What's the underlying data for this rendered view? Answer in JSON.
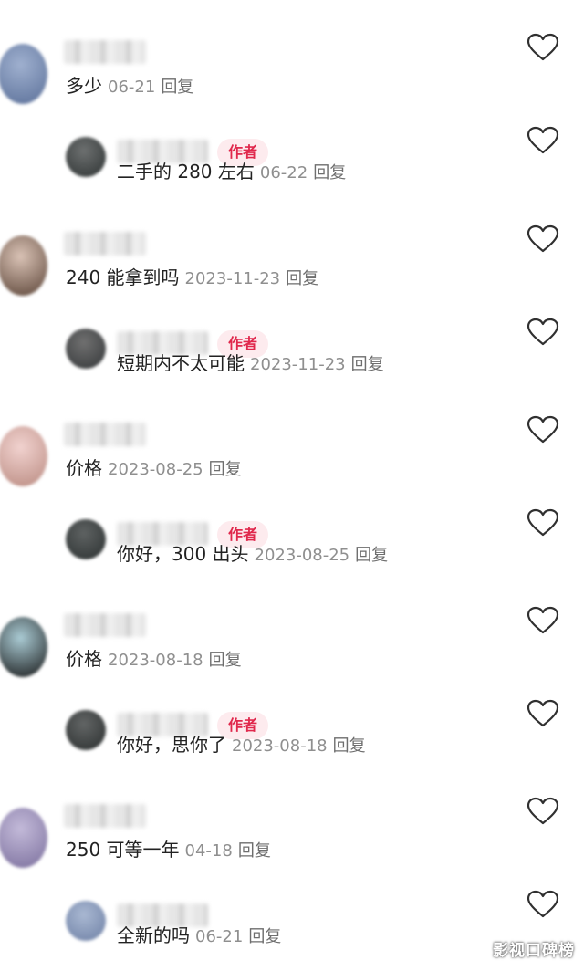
{
  "author_badge": "作者",
  "reply_label": "回复",
  "accent_color": "#e0284c",
  "watermark": "影视口碑榜",
  "comments": [
    {
      "type": "top",
      "text": "多少",
      "date": "06-21",
      "avatar_colors": [
        "#9fb0cf",
        "#5a6f98"
      ]
    },
    {
      "type": "reply",
      "text": "二手的 280 左右",
      "date": "06-22",
      "author": true,
      "avatar_colors": [
        "#6d7070",
        "#2d3232"
      ]
    },
    {
      "type": "top",
      "text": "240 能拿到吗",
      "date": "2023-11-23",
      "avatar_colors": [
        "#d9c2b5",
        "#5a4336"
      ]
    },
    {
      "type": "reply",
      "text": "短期内不太可能",
      "date": "2023-11-23",
      "author": true,
      "avatar_colors": [
        "#707070",
        "#333638"
      ]
    },
    {
      "type": "top",
      "text": "价格",
      "date": "2023-08-25",
      "avatar_colors": [
        "#f1d2cf",
        "#b98a80"
      ]
    },
    {
      "type": "reply",
      "text": "你好，300 出头",
      "date": "2023-08-25",
      "author": true,
      "avatar_colors": [
        "#5e6262",
        "#2b3030"
      ]
    },
    {
      "type": "top",
      "text": "价格",
      "date": "2023-08-18",
      "avatar_colors": [
        "#aacbd4",
        "#151515"
      ]
    },
    {
      "type": "reply",
      "text": "你好，思你了",
      "date": "2023-08-18",
      "author": true,
      "avatar_colors": [
        "#626565",
        "#2a2e2e"
      ]
    },
    {
      "type": "top",
      "text": "250 可等一年",
      "date": "04-18",
      "avatar_colors": [
        "#c3bad9",
        "#7a6e9c"
      ]
    },
    {
      "type": "reply",
      "text": "全新的吗",
      "date": "06-21",
      "author": false,
      "avatar_colors": [
        "#a9b8d2",
        "#6d7fa4"
      ]
    }
  ]
}
